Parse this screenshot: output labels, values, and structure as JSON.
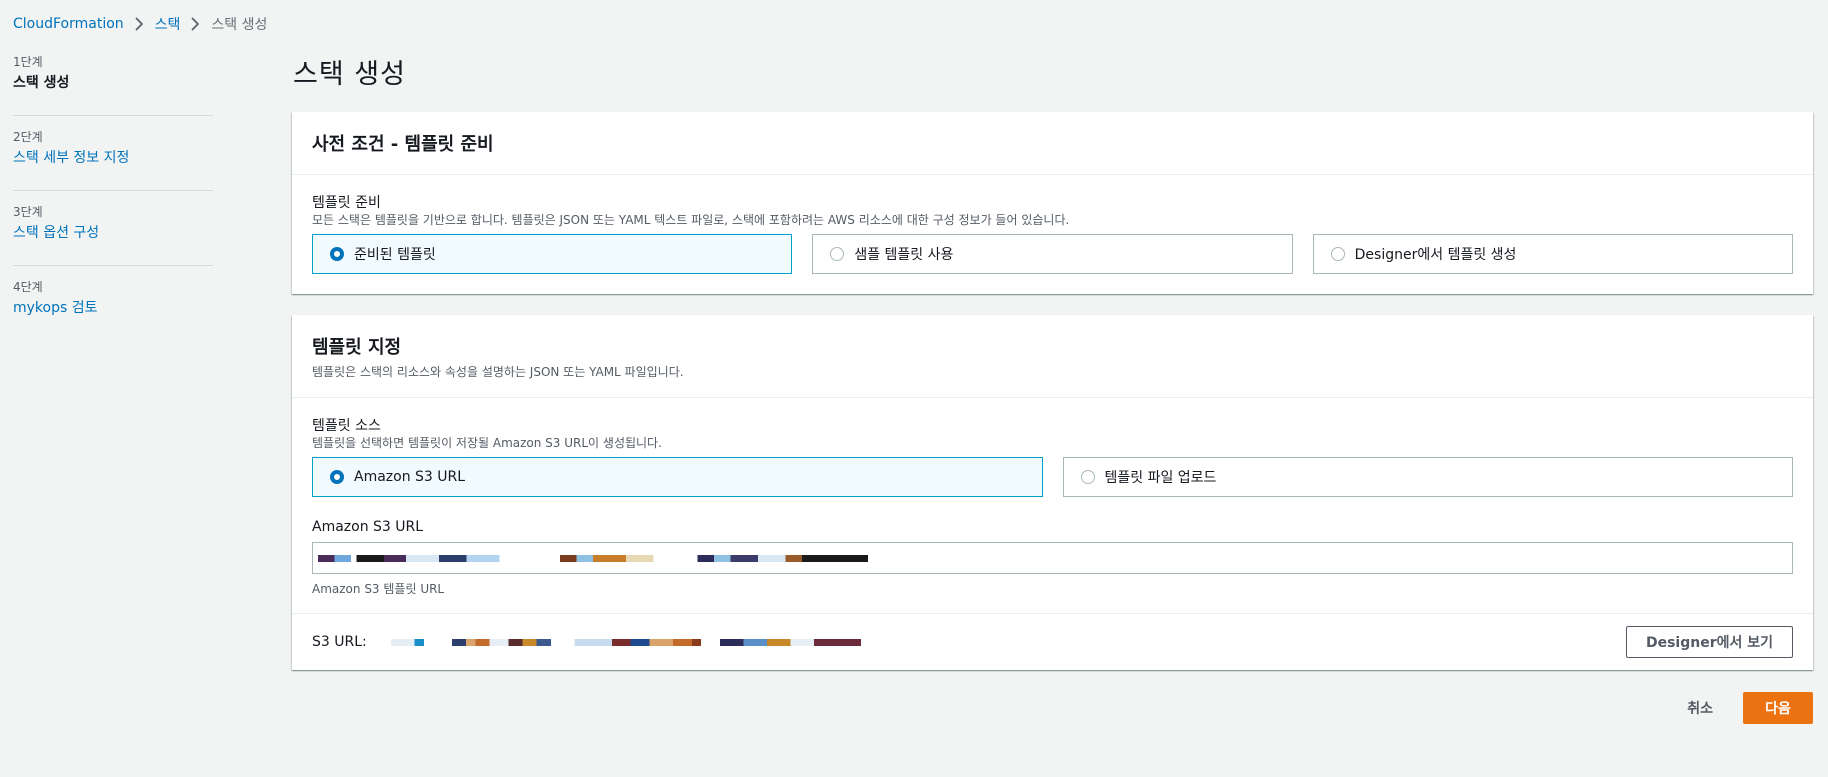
{
  "breadcrumb": {
    "items": [
      "CloudFormation",
      "스택",
      "스택 생성"
    ]
  },
  "steps": [
    {
      "num": "1단계",
      "label": "스택 생성"
    },
    {
      "num": "2단계",
      "label": "스택 세부 정보 지정"
    },
    {
      "num": "3단계",
      "label": "스택 옵션 구성"
    },
    {
      "num": "4단계",
      "label": "mykops 검토"
    }
  ],
  "page_title": "스택 생성",
  "prereq": {
    "title": "사전 조건 - 템플릿 준비",
    "field_label": "템플릿 준비",
    "field_desc": "모든 스택은 템플릿을 기반으로 합니다. 템플릿은 JSON 또는 YAML 텍스트 파일로, 스택에 포함하려는 AWS 리소스에 대한 구성 정보가 들어 있습니다.",
    "options": [
      "준비된 템플릿",
      "샘플 템플릿 사용",
      "Designer에서 템플릿 생성"
    ],
    "selected_index": 0
  },
  "specify": {
    "title": "템플릿 지정",
    "desc": "템플릿은 스택의 리소스와 속성을 설명하는 JSON 또는 YAML 파일입니다.",
    "source_label": "템플릿 소스",
    "source_desc": "템플릿을 선택하면 템플릿이 저장될 Amazon S3 URL이 생성됩니다.",
    "source_options": [
      "Amazon S3 URL",
      "템플릿 파일 업로드"
    ],
    "selected_index": 0,
    "url_label": "Amazon S3 URL",
    "url_hint": "Amazon S3 템플릿 URL",
    "s3_url_label": "S3 URL:",
    "designer_button": "Designer에서 보기"
  },
  "footer": {
    "cancel": "취소",
    "next": "다음"
  },
  "colors": {
    "link": "#0073bb",
    "primary": "#ec7211",
    "selected_border": "#00a1c9"
  }
}
